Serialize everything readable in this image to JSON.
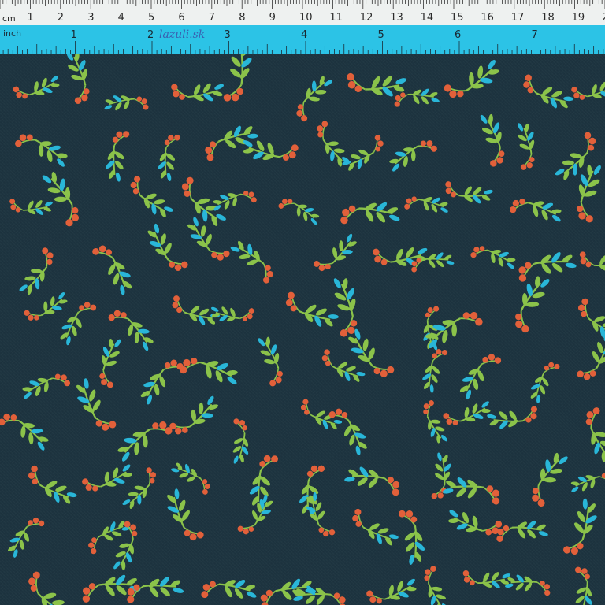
{
  "ruler": {
    "cm_unit": "cm",
    "inch_unit": "inch",
    "brand": "lazuli.sk",
    "cm_ticks": [
      "1",
      "2",
      "3",
      "4",
      "5",
      "6",
      "7",
      "8",
      "9",
      "10",
      "11",
      "12",
      "13",
      "14",
      "15",
      "16",
      "17",
      "18",
      "19",
      "2"
    ],
    "inch_ticks": [
      "1",
      "2",
      "3",
      "4",
      "5",
      "6",
      "7"
    ]
  },
  "colors": {
    "fabric_background": "#1d3440",
    "leaf_green": "#8bc34a",
    "leaf_blue": "#29b6d8",
    "berry_orange": "#e2603a",
    "ruler_cm_bg": "#eef1f0",
    "ruler_inch_bg": "#2cc3e6"
  },
  "pattern": {
    "motif": "leaf sprigs with berries",
    "background": "dark teal fabric"
  }
}
